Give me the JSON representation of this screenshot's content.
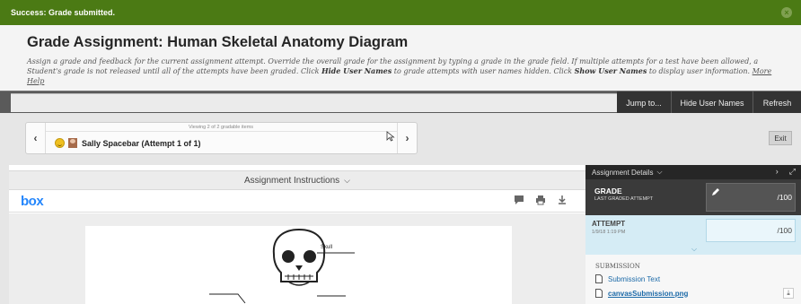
{
  "banner": {
    "message": "Success: Grade submitted."
  },
  "header": {
    "title": "Grade Assignment: Human Skeletal Anatomy Diagram",
    "desc_1": "Assign a grade and feedback for the current assignment attempt. Override the overall grade for the assignment by typing a grade in the grade field. If multiple attempts for a test have been allowed, a Student's grade is not released until all of the attempts have been graded. Click ",
    "hide_bold": "Hide User Names",
    "desc_2": " to grade attempts with user names hidden. Click ",
    "show_bold": "Show User Names",
    "desc_3": " to display user information. ",
    "more_help": "More Help"
  },
  "toolbar": {
    "jump_to": "Jump to...",
    "hide_user_names": "Hide User Names",
    "refresh": "Refresh"
  },
  "navigator": {
    "viewing": "Viewing 2 of 2 gradable items",
    "student": "Sally Spacebar (Attempt 1 of 1)",
    "exit": "Exit"
  },
  "content": {
    "instructions_label": "Assignment Instructions",
    "viewer_logo": "box",
    "diagram_label": "Skull"
  },
  "panel": {
    "title": "Assignment Details",
    "grade_label": "GRADE",
    "grade_sub": "LAST GRADED ATTEMPT",
    "grade_max": "/100",
    "attempt_label": "ATTEMPT",
    "attempt_date": "1/9/18 1:19 PM",
    "attempt_max": "/100",
    "submission_label": "SUBMISSION",
    "submission_text": "Submission Text",
    "file_name": "canvasSubmission.png"
  },
  "colors": {
    "banner": "#4b7a14",
    "box_blue": "#2486fc",
    "attempt_bg": "#d5ecf5",
    "link": "#1c6aa8"
  }
}
